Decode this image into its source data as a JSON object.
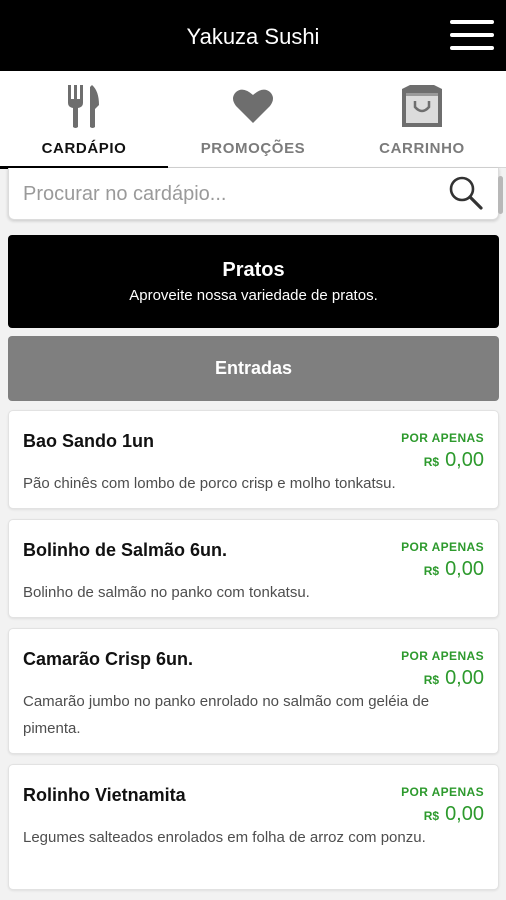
{
  "app": {
    "title": "Yakuza Sushi"
  },
  "tabs": [
    {
      "label": "CARDÁPIO",
      "icon": "fork-knife-icon",
      "active": true
    },
    {
      "label": "PROMOÇÕES",
      "icon": "heart-icon",
      "active": false
    },
    {
      "label": "CARRINHO",
      "icon": "shopping-bag-icon",
      "active": false
    }
  ],
  "search": {
    "placeholder": "Procurar no cardápio...",
    "value": ""
  },
  "category": {
    "title": "Pratos",
    "subtitle": "Aproveite nossa variedade de pratos."
  },
  "section": {
    "label": "Entradas"
  },
  "products": [
    {
      "name": "Bao Sando 1un",
      "description": "Pão chinês com lombo de porco crisp e molho tonkatsu.",
      "price_label": "POR APENAS",
      "currency": "R$",
      "price": "0,00"
    },
    {
      "name": "Bolinho de Salmão 6un.",
      "description": "Bolinho de salmão no panko com tonkatsu.",
      "price_label": "POR APENAS",
      "currency": "R$",
      "price": "0,00"
    },
    {
      "name": "Camarão Crisp 6un.",
      "description": "Camarão jumbo no panko enrolado no salmão com geléia de pimenta.",
      "price_label": "POR APENAS",
      "currency": "R$",
      "price": "0,00"
    },
    {
      "name": "Rolinho Vietnamita",
      "description": "Legumes salteados enrolados em folha de arroz com ponzu.",
      "price_label": "POR APENAS",
      "currency": "R$",
      "price": "0,00"
    }
  ],
  "colors": {
    "header_bg": "#000000",
    "section_bg": "#7f7f7f",
    "price_green": "#2d9a2d",
    "icon_gray": "#6e6e6e"
  }
}
